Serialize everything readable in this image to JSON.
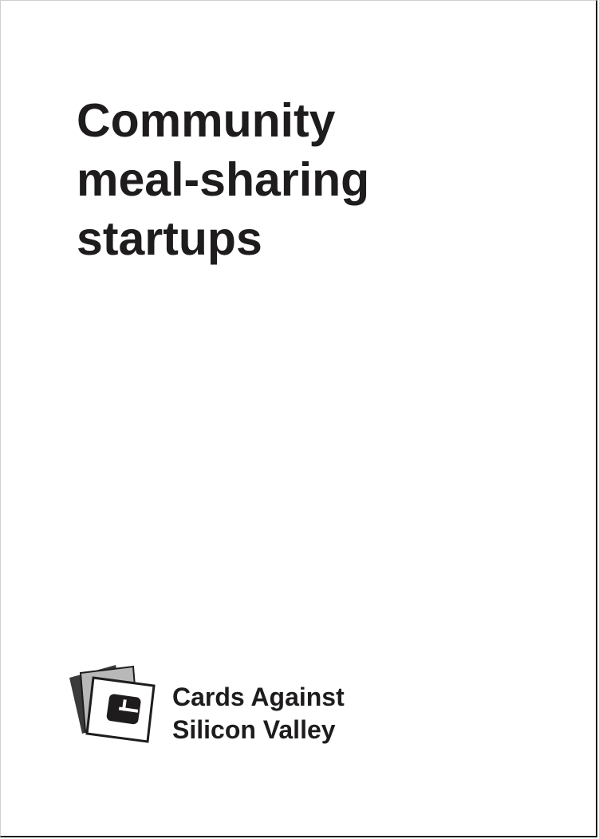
{
  "card": {
    "text_lines": [
      "Community",
      "meal-sharing",
      "startups"
    ]
  },
  "brand": {
    "line1": "Cards Against",
    "line2": "Silicon Valley",
    "logo_icon": "stacked-cards-logo-icon"
  },
  "colors": {
    "text": "#1e1c1d",
    "background": "#ffffff",
    "card_back_dark": "#3a3a3a",
    "card_back_gray": "#b8b8b8"
  }
}
